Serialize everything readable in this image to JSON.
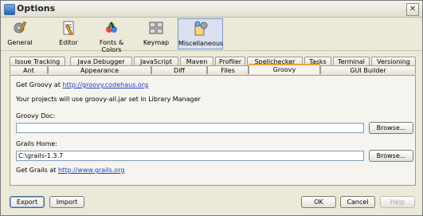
{
  "window": {
    "title": "Options",
    "close_label": "✕"
  },
  "categories": [
    {
      "label": "General",
      "icon": "gear-wrench-icon",
      "active": false
    },
    {
      "label": "Editor",
      "icon": "editor-icon",
      "active": false
    },
    {
      "label": "Fonts & Colors",
      "icon": "fonts-colors-icon",
      "active": false
    },
    {
      "label": "Keymap",
      "icon": "keymap-icon",
      "active": false
    },
    {
      "label": "Miscellaneous",
      "icon": "miscellaneous-icon",
      "active": true
    }
  ],
  "tabs_row1": [
    "Issue Tracking",
    "Java Debugger",
    "JavaScript",
    "Maven",
    "Profiler",
    "Spellchecker",
    "Tasks",
    "Terminal",
    "Versioning"
  ],
  "tabs_row2": [
    "Ant",
    "Appearance",
    "Diff",
    "Files",
    "Groovy",
    "GUI Builder"
  ],
  "selected_tab": "Groovy",
  "groovy": {
    "get_groovy_prefix": "Get Groovy at",
    "groovy_url": "http://groovy.codehaus.org",
    "library_note": "Your projects will use groovy-all.jar set in Library Manager",
    "groovy_doc_label": "Groovy Doc:",
    "groovy_doc_value": "",
    "grails_home_label": "Grails Home:",
    "grails_home_value": "C:\\grails-1.3.7",
    "browse_label": "Browse...",
    "get_grails_prefix": "Get Grails at",
    "grails_url": "http://www.grails.org"
  },
  "footer": {
    "export_label": "Export",
    "import_label": "Import",
    "ok_label": "OK",
    "cancel_label": "Cancel",
    "help_label": "Help"
  }
}
